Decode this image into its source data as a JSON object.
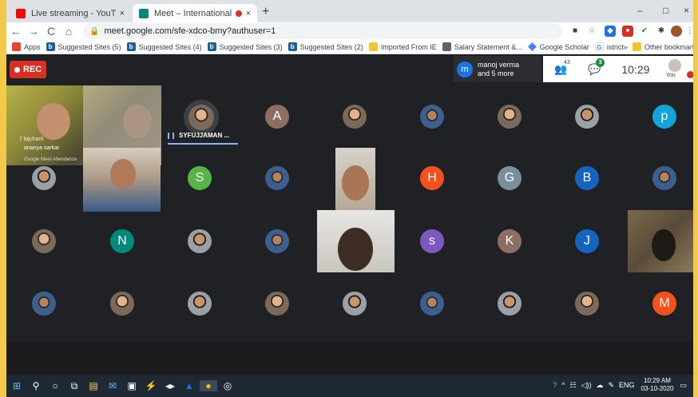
{
  "tabs": [
    {
      "title": "Live streaming - YouTube Studio",
      "close": "×"
    },
    {
      "title": "Meet – International Webina",
      "close": "×"
    }
  ],
  "new_tab": "+",
  "window": {
    "minimize": "–",
    "maximize": "□",
    "close": "×"
  },
  "url": "meet.google.com/sfe-xdco-bmy?authuser=1",
  "bookmarks": {
    "apps": "Apps",
    "items": [
      "Suggested Sites (5)",
      "Suggested Sites (4)",
      "Suggested Sites (3)",
      "Suggested Sites (2)",
      "Imported From IE",
      "Salary Statement &...",
      "Google Scholar",
      "istrict"
    ],
    "more": "»",
    "other": "Other bookmarks"
  },
  "meet": {
    "rec_label": "REC",
    "presenter": {
      "initial": "m",
      "line1": "manoj verma",
      "line2": "and 5 more"
    },
    "participants_count": "43",
    "chat_badge": "3",
    "time": "10:29",
    "you": "You",
    "speaker_name": "SYFUJJAMAN ...",
    "overlay_names": [
      "7 bijuharit",
      "ananya sarkar",
      "Google Meet Attendance"
    ]
  },
  "tiles": [
    {
      "id": "A",
      "initial": "A",
      "color": "#8d6e63"
    },
    {
      "id": "p",
      "initial": "p",
      "color": "#12a4d9"
    },
    {
      "id": "S",
      "initial": "S",
      "color": "#56b449"
    },
    {
      "id": "H",
      "initial": "H",
      "color": "#f4511e"
    },
    {
      "id": "G",
      "initial": "G",
      "color": "#78909c"
    },
    {
      "id": "B",
      "initial": "B",
      "color": "#1565c0"
    },
    {
      "id": "N",
      "initial": "N",
      "color": "#00897b"
    },
    {
      "id": "s",
      "initial": "s",
      "color": "#7e57c2"
    },
    {
      "id": "K",
      "initial": "K",
      "color": "#8d6e63"
    },
    {
      "id": "J",
      "initial": "J",
      "color": "#1565c0"
    },
    {
      "id": "M",
      "initial": "M",
      "color": "#f4511e"
    }
  ],
  "taskbar": {
    "lang": "ENG",
    "time": "10:29 AM",
    "date": "03-10-2020"
  }
}
